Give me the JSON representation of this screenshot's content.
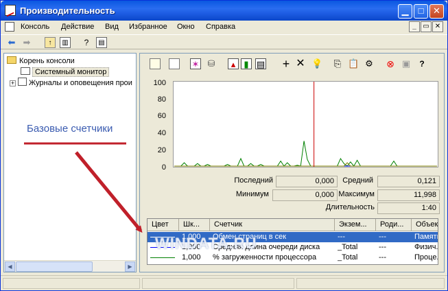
{
  "window": {
    "title": "Производительность"
  },
  "menubar": {
    "items": [
      "Консоль",
      "Действие",
      "Вид",
      "Избранное",
      "Окно",
      "Справка"
    ]
  },
  "tree": {
    "items": [
      {
        "label": "Корень консоли"
      },
      {
        "label": "Системный монитор"
      },
      {
        "label": "Журналы и оповещения прои"
      }
    ]
  },
  "graph": {
    "y_ticks": [
      "100",
      "80",
      "60",
      "40",
      "20",
      "0"
    ]
  },
  "chart_data": {
    "type": "line",
    "ylim": [
      0,
      100
    ],
    "grid": false,
    "series": [
      {
        "color": "#008000",
        "values": [
          0,
          0,
          0,
          4,
          0,
          0,
          0,
          3,
          0,
          0,
          2,
          0,
          0,
          0,
          0,
          0,
          2,
          0,
          0,
          0,
          9,
          0,
          0,
          3,
          0,
          0,
          2,
          0,
          0,
          0,
          0,
          0,
          6,
          0,
          4,
          0,
          0,
          1,
          0,
          30,
          8,
          0,
          0,
          0,
          0,
          0,
          0,
          0,
          0,
          0,
          9,
          3,
          0,
          5,
          0,
          7,
          0,
          0,
          0,
          0,
          0,
          0,
          0,
          0,
          0,
          0,
          6,
          0,
          0,
          0,
          0,
          0,
          0,
          0,
          0,
          0,
          0,
          0,
          0,
          0
        ]
      },
      {
        "color": "#0000ff",
        "values": [
          0,
          0,
          0,
          0,
          0,
          0,
          0,
          0,
          0,
          0,
          0,
          0,
          0,
          0,
          0,
          0,
          0,
          0,
          0,
          0,
          0,
          0,
          0,
          0,
          0,
          0,
          0,
          0,
          0,
          0,
          0,
          0,
          0,
          0,
          0,
          0,
          0,
          0,
          0,
          0,
          0,
          0,
          0,
          0,
          0,
          0,
          0,
          0,
          0,
          0,
          0,
          0,
          0,
          0,
          0,
          0,
          0,
          0,
          0,
          0,
          0,
          0,
          0,
          0,
          0,
          0,
          0,
          0,
          0,
          0,
          0,
          0,
          0,
          0,
          0,
          0,
          0,
          0,
          0,
          0
        ]
      },
      {
        "color": "#808000",
        "values": [
          0,
          0,
          0,
          0,
          0,
          0,
          0,
          0,
          0,
          0,
          0,
          0,
          0,
          0,
          0,
          0,
          0,
          0,
          0,
          0,
          0,
          0,
          0,
          0,
          0,
          0,
          0,
          0,
          0,
          0,
          0,
          0,
          0,
          0,
          0,
          0,
          0,
          0,
          0,
          0,
          0,
          0,
          0,
          0,
          0,
          0,
          0,
          0,
          0,
          0,
          0,
          0,
          4,
          0,
          0,
          0,
          0,
          0,
          0,
          0,
          0,
          0,
          0,
          0,
          0,
          0,
          0,
          0,
          0,
          0,
          0,
          0,
          0,
          0,
          0,
          0,
          0,
          0,
          0,
          0
        ]
      }
    ],
    "cursor_index": 42
  },
  "stats": {
    "last_label": "Последний",
    "last_value": "0,000",
    "avg_label": "Средний",
    "avg_value": "0,121",
    "min_label": "Минимум",
    "min_value": "0,000",
    "max_label": "Максимум",
    "max_value": "11,998",
    "dur_label": "Длительность",
    "dur_value": "1:40"
  },
  "table": {
    "headers": [
      "Цвет",
      "Шк...",
      "Счетчик",
      "Экзем...",
      "Роди...",
      "Объек"
    ],
    "rows": [
      {
        "color": "#0000ff",
        "scale": "1,000",
        "counter": "Обмен страниц в сек",
        "instance": "---",
        "parent": "---",
        "object": "Памяти"
      },
      {
        "color": "#0000ff",
        "scale": "1,000",
        "counter": "Средняя длина очереди диска",
        "instance": "_Total",
        "parent": "---",
        "object": "Физич..."
      },
      {
        "color": "#008000",
        "scale": "1,000",
        "counter": "% загруженности процессора",
        "instance": "_Total",
        "parent": "---",
        "object": "Проце..."
      }
    ]
  },
  "annotation": {
    "text": "Базовые счетчики",
    "color": "#c0202a"
  },
  "watermark": "WINDATA.RU"
}
